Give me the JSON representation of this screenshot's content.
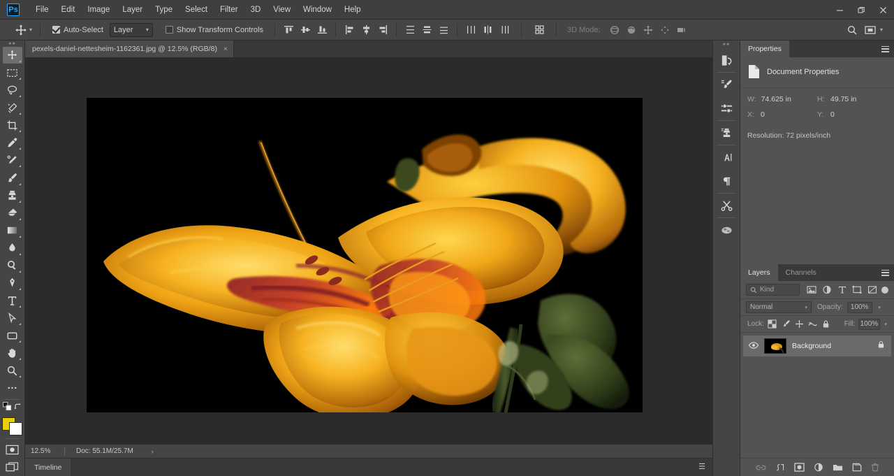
{
  "menubar": {
    "logo": "Ps",
    "items": [
      "File",
      "Edit",
      "Image",
      "Layer",
      "Type",
      "Select",
      "Filter",
      "3D",
      "View",
      "Window",
      "Help"
    ],
    "window_controls": [
      "minimize",
      "restore",
      "close"
    ]
  },
  "options_bar": {
    "tool_icon": "move-tool-icon",
    "auto_select_label": "Auto-Select",
    "auto_select_checked": true,
    "auto_select_target": "Layer",
    "show_transform_label": "Show Transform Controls",
    "show_transform_checked": false,
    "align_buttons": [
      "align-top-edges",
      "align-vertical-centers",
      "align-bottom-edges",
      "align-left-edges",
      "align-horizontal-centers",
      "align-right-edges"
    ],
    "distribute_buttons": [
      "distribute-top-edges",
      "distribute-vertical-centers",
      "distribute-bottom-edges",
      "distribute-left-edges",
      "distribute-horizontal-centers",
      "distribute-right-edges"
    ],
    "extras_button": "align-and-distribute-icon",
    "mode_3d_label": "3D Mode:",
    "mode_3d_buttons": [
      "orbit-3d-icon",
      "roll-3d-icon",
      "pan-3d-icon",
      "slide-3d-icon",
      "scale-3d-icon"
    ],
    "search_icon": "search-icon",
    "workspace_icon": "arrange-documents-icon"
  },
  "document_tab": {
    "title": "pexels-daniel-nettesheim-1162361.jpg @ 12.5% (RGB/8)",
    "close": "×"
  },
  "toolbar": {
    "tools": [
      {
        "name": "move-tool",
        "active": true
      },
      {
        "name": "rectangular-marquee-tool",
        "active": false
      },
      {
        "name": "lasso-tool",
        "active": false
      },
      {
        "name": "quick-selection-tool",
        "active": false
      },
      {
        "name": "crop-tool",
        "active": false
      },
      {
        "name": "eyedropper-tool",
        "active": false
      },
      {
        "name": "spot-healing-brush-tool",
        "active": false
      },
      {
        "name": "brush-tool",
        "active": false
      },
      {
        "name": "clone-stamp-tool",
        "active": false
      },
      {
        "name": "eraser-tool",
        "active": false
      },
      {
        "name": "gradient-tool",
        "active": false
      },
      {
        "name": "blur-tool",
        "active": false
      },
      {
        "name": "dodge-tool",
        "active": false
      },
      {
        "name": "pen-tool",
        "active": false
      },
      {
        "name": "horizontal-type-tool",
        "active": false
      },
      {
        "name": "path-selection-tool",
        "active": false
      },
      {
        "name": "rectangle-tool",
        "active": false
      },
      {
        "name": "hand-tool",
        "active": false
      },
      {
        "name": "zoom-tool",
        "active": false
      },
      {
        "name": "edit-toolbar-more",
        "active": false
      }
    ],
    "foreground_color": "#ecd100",
    "background_color": "#ffffff",
    "quick_mask": "quick-mask-icon",
    "screen_mode": "screen-mode-icon"
  },
  "canvas": {
    "image_alt": "yellow daylily flower on black background",
    "background_color": "#2b2b2b",
    "artboard_color": "#000000"
  },
  "status_bar": {
    "zoom": "12.5%",
    "doc_info": "Doc: 55.1M/25.7M",
    "expand_arrow": "›"
  },
  "timeline_panel": {
    "tab": "Timeline",
    "menu_icon": "panel-menu-icon"
  },
  "icon_rail": {
    "items": [
      "history-icon",
      "brush-settings-icon",
      "adjustments-icon",
      "clone-source-icon",
      "character-icon",
      "paragraph-icon",
      "actions-icon",
      "3d-materials-icon"
    ]
  },
  "properties_panel": {
    "tabs": [
      {
        "label": "Properties",
        "active": true
      }
    ],
    "menu_icon": "panel-menu-icon",
    "section_title": "Document Properties",
    "section_icon": "document-icon",
    "fields": [
      {
        "label": "W:",
        "value": "74.625 in"
      },
      {
        "label": "H:",
        "value": "49.75 in"
      },
      {
        "label": "X:",
        "value": "0"
      },
      {
        "label": "Y:",
        "value": "0"
      }
    ],
    "resolution": "Resolution: 72 pixels/inch"
  },
  "layers_panel": {
    "tabs": [
      {
        "label": "Layers",
        "active": true
      },
      {
        "label": "Channels",
        "active": false
      }
    ],
    "menu_icon": "panel-menu-icon",
    "filter": {
      "search_icon": "search-icon",
      "kind_label": "Kind",
      "type_filters": [
        "filter-pixel-icon",
        "filter-adjustment-icon",
        "filter-type-icon",
        "filter-shape-icon",
        "filter-smart-object-icon"
      ],
      "toggle": "filter-enable-toggle"
    },
    "blend_mode": "Normal",
    "opacity_label": "Opacity:",
    "opacity_value": "100%",
    "lock_label": "Lock:",
    "lock_icons": [
      "lock-transparent-pixels-icon",
      "lock-image-pixels-icon",
      "lock-position-icon",
      "lock-artboard-nesting-icon",
      "lock-all-icon"
    ],
    "fill_label": "Fill:",
    "fill_value": "100%",
    "layers": [
      {
        "name": "Background",
        "visible": true,
        "locked": true,
        "selected": true
      }
    ],
    "footer_icons": [
      "link-layers-icon",
      "add-layer-style-icon",
      "add-layer-mask-icon",
      "new-fill-adjustment-icon",
      "new-group-icon",
      "new-layer-icon",
      "delete-layer-icon"
    ]
  }
}
